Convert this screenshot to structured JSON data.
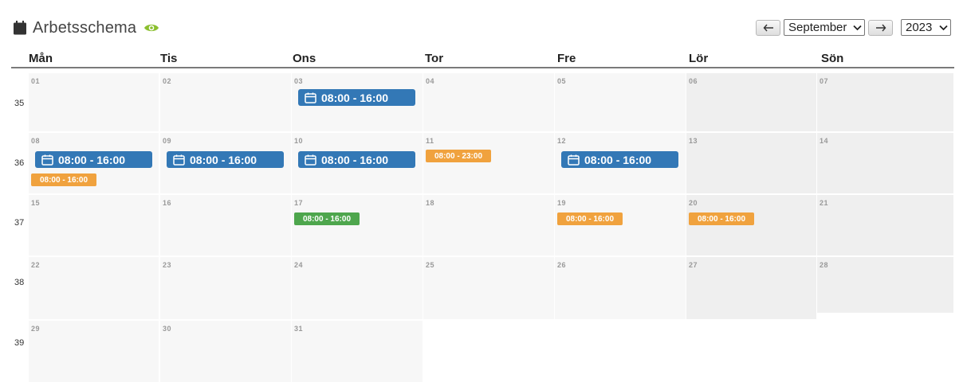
{
  "header": {
    "title": "Arbetsschema",
    "icon": "calendar-icon",
    "view_icon": "eye-icon",
    "accent": "#8bbf2f"
  },
  "controls": {
    "prev_icon": "arrow-left-icon",
    "next_icon": "arrow-right-icon",
    "month": "September",
    "year": "2023"
  },
  "weekdays": [
    "Mån",
    "Tis",
    "Ons",
    "Tor",
    "Fre",
    "Lör",
    "Sön"
  ],
  "weeks": [
    {
      "number": "35",
      "days": [
        "01",
        "02",
        "03",
        "04",
        "05",
        "06",
        "07"
      ]
    },
    {
      "number": "36",
      "days": [
        "08",
        "09",
        "10",
        "11",
        "12",
        "13",
        "14"
      ]
    },
    {
      "number": "37",
      "days": [
        "15",
        "16",
        "17",
        "18",
        "19",
        "20",
        "21"
      ]
    },
    {
      "number": "38",
      "days": [
        "22",
        "23",
        "24",
        "25",
        "26",
        "27",
        "28"
      ]
    },
    {
      "number": "39",
      "days": [
        "29",
        "30",
        "31"
      ]
    }
  ],
  "events": [
    {
      "date": "03",
      "label": "08:00 - 16:00",
      "style": "block",
      "color": "#3378b6"
    },
    {
      "date": "08",
      "label": "08:00 - 16:00",
      "style": "block",
      "color": "#3378b6"
    },
    {
      "date": "08",
      "label": "08:00 - 16:00",
      "style": "badge",
      "color": "#f0a23e"
    },
    {
      "date": "09",
      "label": "08:00 - 16:00",
      "style": "block",
      "color": "#3378b6"
    },
    {
      "date": "10",
      "label": "08:00 - 16:00",
      "style": "block",
      "color": "#3378b6"
    },
    {
      "date": "11",
      "label": "08:00 - 23:00",
      "style": "badge",
      "color": "#f0a23e"
    },
    {
      "date": "12",
      "label": "08:00 - 16:00",
      "style": "block",
      "color": "#3378b6"
    },
    {
      "date": "17",
      "label": "08:00 - 16:00",
      "style": "badge",
      "color": "#4ea64d"
    },
    {
      "date": "19",
      "label": "08:00 - 16:00",
      "style": "badge",
      "color": "#f0a23e"
    },
    {
      "date": "20",
      "label": "08:00 - 16:00",
      "style": "badge",
      "color": "#f0a23e"
    }
  ]
}
